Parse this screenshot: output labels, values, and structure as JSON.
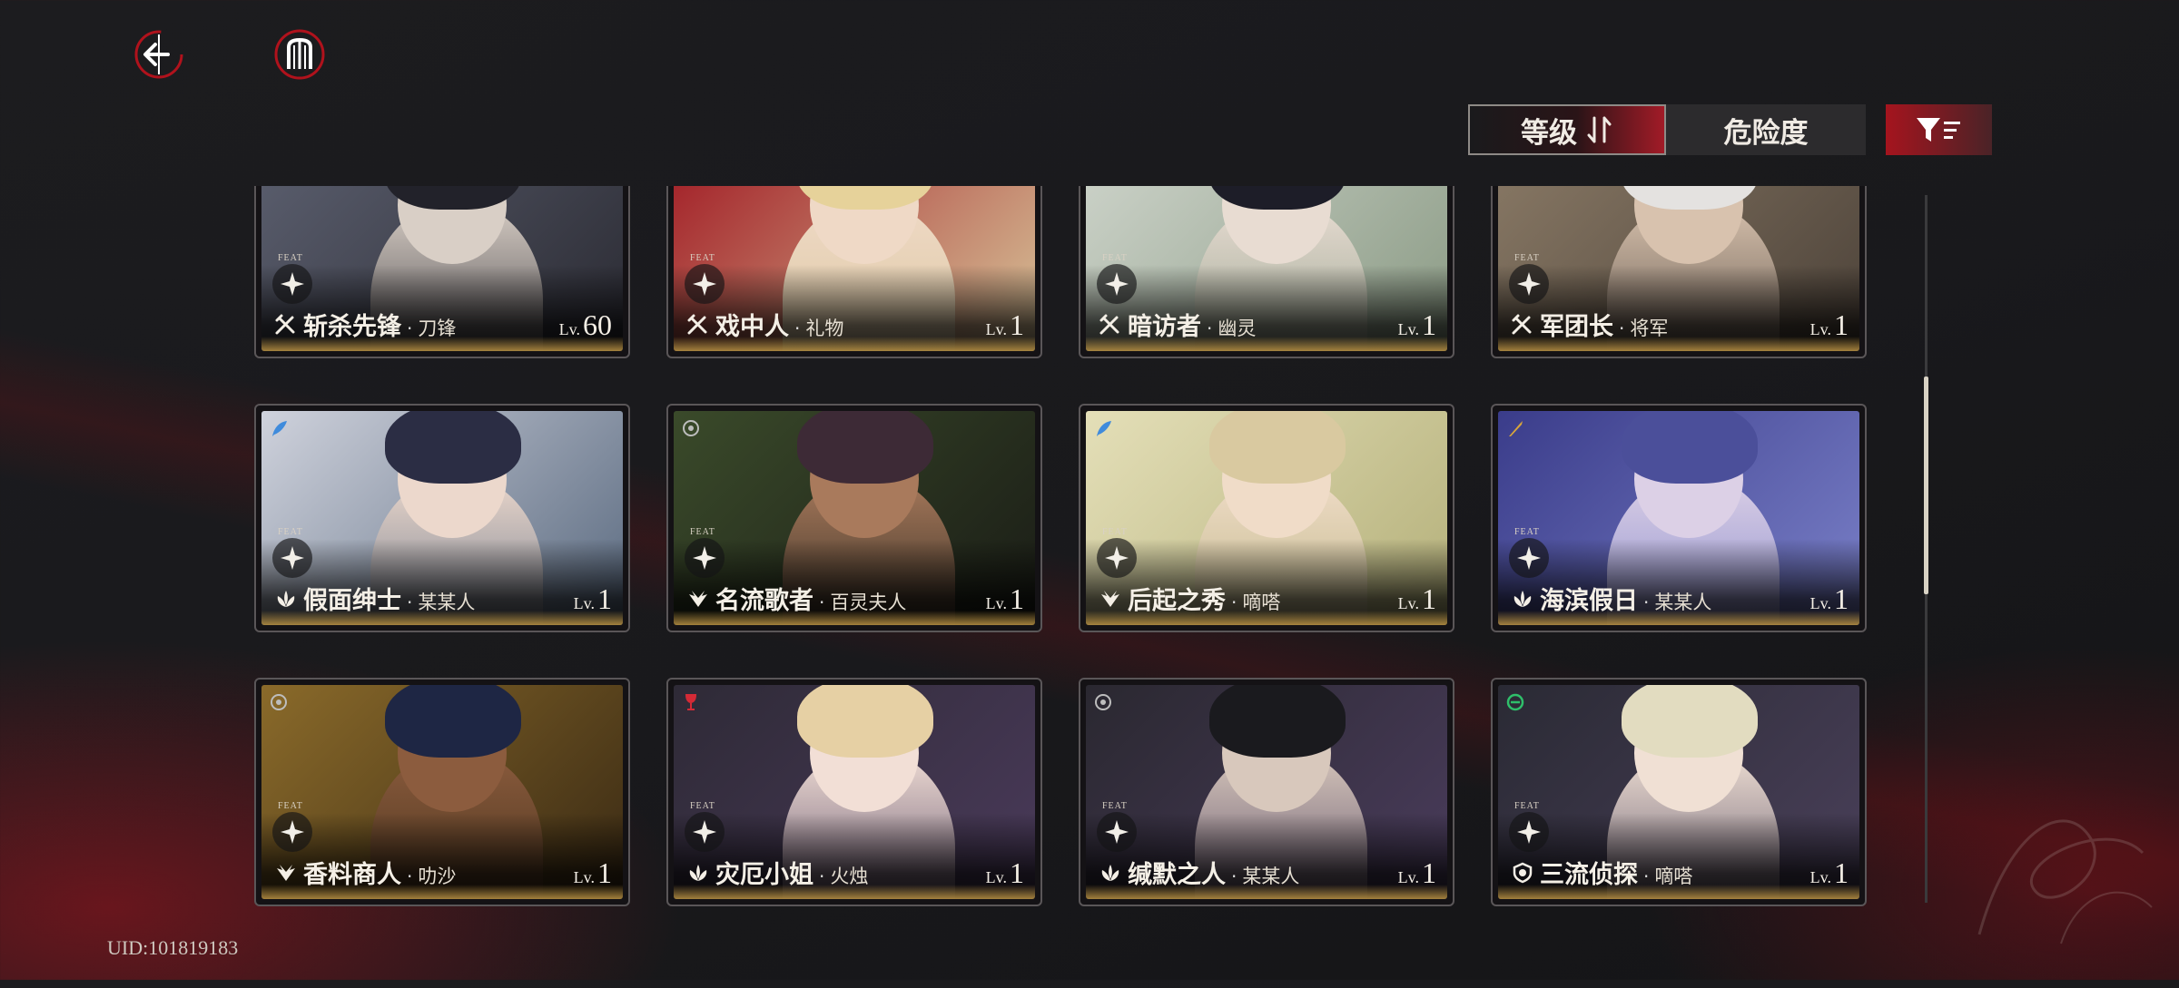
{
  "header": {
    "back_icon": "back-arrow-icon",
    "menu_icon": "menu-emblem-icon"
  },
  "sort": {
    "level_label": "等级",
    "level_icon": "sort-order-icon",
    "danger_label": "危险度",
    "filter_icon": "filter-icon"
  },
  "cards": [
    {
      "name": "斩杀先锋",
      "sub": "刀锋",
      "lv_prefix": "Lv.",
      "level": "60",
      "feat": "FEAT",
      "role_icon": "blade-icon",
      "badge": "",
      "tint": "#5c6070",
      "tint2": "#2a2a32",
      "hair": "#22222a",
      "skin": "#d9cfc6"
    },
    {
      "name": "戏中人",
      "sub": "礼物",
      "lv_prefix": "Lv.",
      "level": "1",
      "feat": "FEAT",
      "role_icon": "blade-icon",
      "badge": "",
      "tint": "#a01822",
      "tint2": "#d8c59a",
      "hair": "#e6d29a",
      "skin": "#efd9c6"
    },
    {
      "name": "暗访者",
      "sub": "幽灵",
      "lv_prefix": "Lv.",
      "level": "1",
      "feat": "FEAT",
      "role_icon": "blade-icon",
      "badge": "",
      "tint": "#cfd5cc",
      "tint2": "#8a9a84",
      "hair": "#1d1d28",
      "skin": "#e8dcd2"
    },
    {
      "name": "军团长",
      "sub": "将军",
      "lv_prefix": "Lv.",
      "level": "1",
      "feat": "FEAT",
      "role_icon": "blade-icon",
      "badge": "",
      "tint": "#8a7a66",
      "tint2": "#4c4239",
      "hair": "#e4e2e0",
      "skin": "#d8c2ae"
    },
    {
      "name": "假面绅士",
      "sub": "某某人",
      "lv_prefix": "Lv.",
      "level": "1",
      "feat": "FEAT",
      "role_icon": "lotus-icon",
      "badge": "feather-badge-icon",
      "tint": "#cfd2dc",
      "tint2": "#5a6a80",
      "hair": "#2b2d44",
      "skin": "#ecd8cc"
    },
    {
      "name": "名流歌者",
      "sub": "百灵夫人",
      "lv_prefix": "Lv.",
      "level": "1",
      "feat": "FEAT",
      "role_icon": "wings-icon",
      "badge": "gear-badge-icon",
      "tint": "#3a4a2a",
      "tint2": "#1a1c16",
      "hair": "#3d2a36",
      "skin": "#a97a5c"
    },
    {
      "name": "后起之秀",
      "sub": "嘀嗒",
      "lv_prefix": "Lv.",
      "level": "1",
      "feat": "FEAT",
      "role_icon": "wings-icon",
      "badge": "feather-badge-icon",
      "tint": "#e4dfb8",
      "tint2": "#b4b07a",
      "hair": "#d9c9a0",
      "skin": "#f0dcc8"
    },
    {
      "name": "海滨假日",
      "sub": "某某人",
      "lv_prefix": "Lv.",
      "level": "1",
      "feat": "FEAT",
      "role_icon": "lotus-icon",
      "badge": "sword-badge-icon",
      "tint": "#3a3c8a",
      "tint2": "#7a80c8",
      "hair": "#4b4f9a",
      "skin": "#dcd0e6"
    },
    {
      "name": "香料商人",
      "sub": "叻沙",
      "lv_prefix": "Lv.",
      "level": "1",
      "feat": "FEAT",
      "role_icon": "wings-icon",
      "badge": "gear-badge-icon",
      "tint": "#8a6a2a",
      "tint2": "#3a2a14",
      "hair": "#1e2644",
      "skin": "#8c5c3e"
    },
    {
      "name": "灾厄小姐",
      "sub": "火烛",
      "lv_prefix": "Lv.",
      "level": "1",
      "feat": "FEAT",
      "role_icon": "lotus-icon",
      "badge": "wine-badge-icon",
      "tint": "#2e2a36",
      "tint2": "#4a3a5a",
      "hair": "#e6d0a4",
      "skin": "#f2dfd6"
    },
    {
      "name": "缄默之人",
      "sub": "某某人",
      "lv_prefix": "Lv.",
      "level": "1",
      "feat": "FEAT",
      "role_icon": "lotus-icon",
      "badge": "gear-badge-icon",
      "tint": "#2a2830",
      "tint2": "#4a3c5c",
      "hair": "#1a1a1e",
      "skin": "#d8c8bc"
    },
    {
      "name": "三流侦探",
      "sub": "嘀嗒",
      "lv_prefix": "Lv.",
      "level": "1",
      "feat": "FEAT",
      "role_icon": "shield-icon",
      "badge": "leaf-badge-icon",
      "tint": "#2a2a34",
      "tint2": "#4a405a",
      "hair": "#e2dcc0",
      "skin": "#f0e0d4"
    }
  ],
  "footer": {
    "uid_text": "UID:101819183"
  },
  "colors": {
    "accent_red": "#a5141e",
    "gold": "#c9a24e",
    "panel_border": "#5a5658"
  }
}
